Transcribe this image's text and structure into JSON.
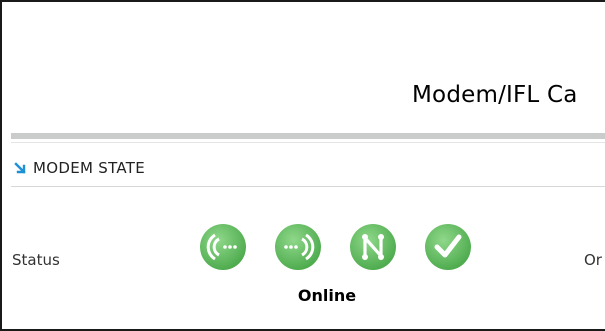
{
  "page": {
    "title": "Modem/IFL Ca"
  },
  "section": {
    "heading": "MODEM STATE"
  },
  "status_row": {
    "label": "Status",
    "value": "Online",
    "right_value": "Or",
    "icons": [
      {
        "name": "receive-signal-icon",
        "color": "#5cb85c"
      },
      {
        "name": "transmit-signal-icon",
        "color": "#5cb85c"
      },
      {
        "name": "network-icon",
        "color": "#5cb85c"
      },
      {
        "name": "online-check-icon",
        "color": "#5cb85c"
      }
    ]
  },
  "colors": {
    "accent_arrow": "#1e90d6",
    "icon_green": "#5cb85c",
    "rule_gray": "#c9cccb"
  }
}
